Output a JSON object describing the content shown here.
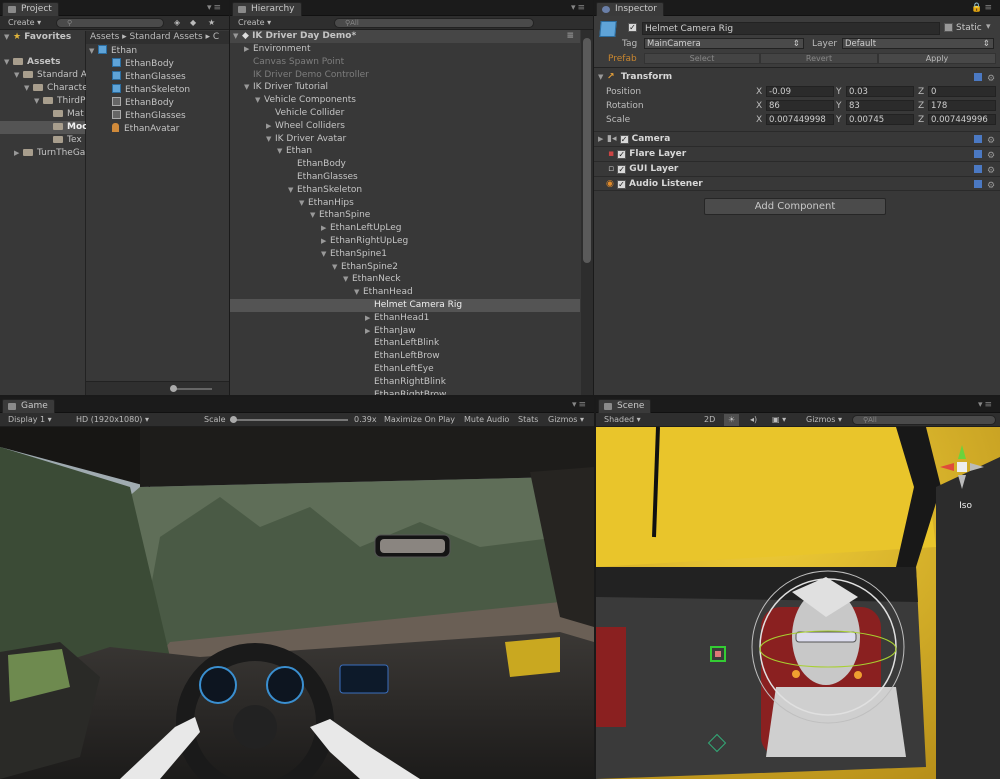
{
  "project": {
    "tab": "Project",
    "create": "Create",
    "favorites": "Favorites",
    "assets": "Assets",
    "tree": [
      "Standard A",
      "Characte",
      "ThirdP",
      "Mat",
      "Moc",
      "Tex",
      "TurnTheGa"
    ],
    "breadcrumb": [
      "Assets",
      "Standard Assets"
    ],
    "files_root": "Ethan",
    "files": [
      "EthanBody",
      "EthanGlasses",
      "EthanSkeleton",
      "EthanBody",
      "EthanGlasses",
      "EthanAvatar"
    ]
  },
  "hierarchy": {
    "tab": "Hierarchy",
    "create": "Create",
    "search_placeholder": "All",
    "scene": "IK Driver Day Demo*",
    "items": [
      {
        "label": "Environment",
        "indent": 0,
        "arrow": "right",
        "dim": false
      },
      {
        "label": "Canvas Spawn Point",
        "indent": 0,
        "arrow": "",
        "dim": true
      },
      {
        "label": "IK Driver Demo Controller",
        "indent": 0,
        "arrow": "",
        "dim": true
      },
      {
        "label": "IK Driver Tutorial",
        "indent": 0,
        "arrow": "down",
        "dim": false
      },
      {
        "label": "Vehicle Components",
        "indent": 1,
        "arrow": "down",
        "dim": false
      },
      {
        "label": "Vehicle Collider",
        "indent": 2,
        "arrow": "",
        "dim": false
      },
      {
        "label": "Wheel Colliders",
        "indent": 2,
        "arrow": "right",
        "dim": false
      },
      {
        "label": "IK Driver Avatar",
        "indent": 2,
        "arrow": "down",
        "dim": false
      },
      {
        "label": "Ethan",
        "indent": 3,
        "arrow": "down",
        "dim": false
      },
      {
        "label": "EthanBody",
        "indent": 4,
        "arrow": "",
        "dim": false
      },
      {
        "label": "EthanGlasses",
        "indent": 4,
        "arrow": "",
        "dim": false
      },
      {
        "label": "EthanSkeleton",
        "indent": 4,
        "arrow": "down",
        "dim": false
      },
      {
        "label": "EthanHips",
        "indent": 5,
        "arrow": "down",
        "dim": false
      },
      {
        "label": "EthanSpine",
        "indent": 6,
        "arrow": "down",
        "dim": false
      },
      {
        "label": "EthanLeftUpLeg",
        "indent": 7,
        "arrow": "right",
        "dim": false
      },
      {
        "label": "EthanRightUpLeg",
        "indent": 7,
        "arrow": "right",
        "dim": false
      },
      {
        "label": "EthanSpine1",
        "indent": 7,
        "arrow": "down",
        "dim": false
      },
      {
        "label": "EthanSpine2",
        "indent": 8,
        "arrow": "down",
        "dim": false
      },
      {
        "label": "EthanNeck",
        "indent": 9,
        "arrow": "down",
        "dim": false
      },
      {
        "label": "EthanHead",
        "indent": 10,
        "arrow": "down",
        "dim": false
      },
      {
        "label": "Helmet Camera Rig",
        "indent": 11,
        "arrow": "",
        "dim": false
      },
      {
        "label": "EthanHead1",
        "indent": 11,
        "arrow": "right",
        "dim": false
      },
      {
        "label": "EthanJaw",
        "indent": 11,
        "arrow": "right",
        "dim": false
      },
      {
        "label": "EthanLeftBlink",
        "indent": 11,
        "arrow": "",
        "dim": false
      },
      {
        "label": "EthanLeftBrow",
        "indent": 11,
        "arrow": "",
        "dim": false
      },
      {
        "label": "EthanLeftEye",
        "indent": 11,
        "arrow": "",
        "dim": false
      },
      {
        "label": "EthanRightBlink",
        "indent": 11,
        "arrow": "",
        "dim": false
      },
      {
        "label": "EthanRightBrow",
        "indent": 11,
        "arrow": "",
        "dim": false
      }
    ],
    "highlighted_index": 20
  },
  "inspector": {
    "tab": "Inspector",
    "object_name": "Helmet Camera Rig",
    "static": "Static",
    "tag_label": "Tag",
    "tag_value": "MainCamera",
    "layer_label": "Layer",
    "layer_value": "Default",
    "prefab": "Prefab",
    "select": "Select",
    "revert": "Revert",
    "apply": "Apply",
    "transform": {
      "title": "Transform",
      "position_label": "Position",
      "rotation_label": "Rotation",
      "scale_label": "Scale",
      "position": [
        "-0.09",
        "0.03",
        "0"
      ],
      "rotation": [
        "86",
        "83",
        "178"
      ],
      "scale": [
        "0.007449998",
        "0.00745",
        "0.007449996"
      ]
    },
    "components": [
      "Camera",
      "Flare Layer",
      "GUI Layer",
      "Audio Listener"
    ],
    "add_component": "Add Component"
  },
  "game": {
    "tab": "Game",
    "display": "Display 1",
    "resolution": "HD (1920x1080)",
    "scale_label": "Scale",
    "scale_value": "0.39x",
    "maximize": "Maximize On Play",
    "mute": "Mute Audio",
    "stats": "Stats",
    "gizmos": "Gizmos"
  },
  "scene": {
    "tab": "Scene",
    "shading": "Shaded",
    "mode_2d": "2D",
    "gizmos": "Gizmos",
    "search_placeholder": "All",
    "projection": "Iso"
  },
  "colors": {
    "selection": "#3e5f96",
    "car_yellow": "#e8c11e",
    "panel": "#383838"
  }
}
